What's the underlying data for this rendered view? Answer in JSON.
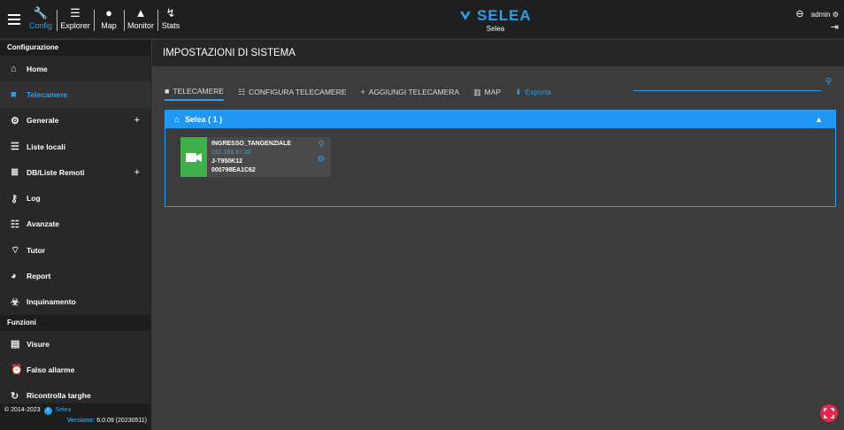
{
  "topbar": {
    "nav": [
      {
        "label": "Config"
      },
      {
        "label": "Explorer"
      },
      {
        "label": "Map"
      },
      {
        "label": "Monitor"
      },
      {
        "label": "Stats"
      }
    ],
    "brand": "SELEA",
    "brand_sub": "Selea",
    "user": "admin"
  },
  "sidebar": {
    "section1": "Configurazione",
    "items": [
      {
        "label": "Home",
        "icon": "home-icon"
      },
      {
        "label": "Telecamere",
        "icon": "camera-icon"
      },
      {
        "label": "Generale",
        "icon": "gear-icon",
        "plus": "+"
      },
      {
        "label": "Liste locali",
        "icon": "list-icon"
      },
      {
        "label": "DB/Liste Remoti",
        "icon": "database-icon",
        "plus": "+"
      },
      {
        "label": "Log",
        "icon": "key-icon"
      },
      {
        "label": "Avanzate",
        "icon": "sliders-icon"
      },
      {
        "label": "Tutor",
        "icon": "wifi-icon"
      },
      {
        "label": "Report",
        "icon": "pie-chart-icon"
      },
      {
        "label": "Inquinamento",
        "icon": "biohazard-icon"
      }
    ],
    "section2": "Funzioni",
    "items2": [
      {
        "label": "Visure",
        "icon": "document-icon"
      },
      {
        "label": "Falso allarme",
        "icon": "alarm-icon"
      },
      {
        "label": "Ricontrolla targhe",
        "icon": "refresh-icon"
      }
    ],
    "footer_copy": "© 2014-2023",
    "footer_brand": "Selea",
    "footer_version_label": "Versione:",
    "footer_version": "6.0.09 (20230511)"
  },
  "main": {
    "title": "IMPOSTAZIONI DI SISTEMA",
    "tabs": [
      {
        "label": "TELECAMERE"
      },
      {
        "label": "CONFIGURA TELECAMERE"
      },
      {
        "label": "AGGIUNGI TELECAMERA"
      },
      {
        "label": "MAP"
      },
      {
        "label": "Esporta"
      }
    ],
    "search_placeholder": "",
    "group": {
      "title": "Selea ( 1 )",
      "card": {
        "name": "INGRESSO_TANGENZIALE",
        "ip": "192.168.87.36",
        "model": "J-T950K12",
        "serial": "000798EA1C62"
      }
    }
  },
  "colors": {
    "accent": "#2f9ee8",
    "active_camera": "#3faf4a",
    "fab": "#e5264f"
  }
}
